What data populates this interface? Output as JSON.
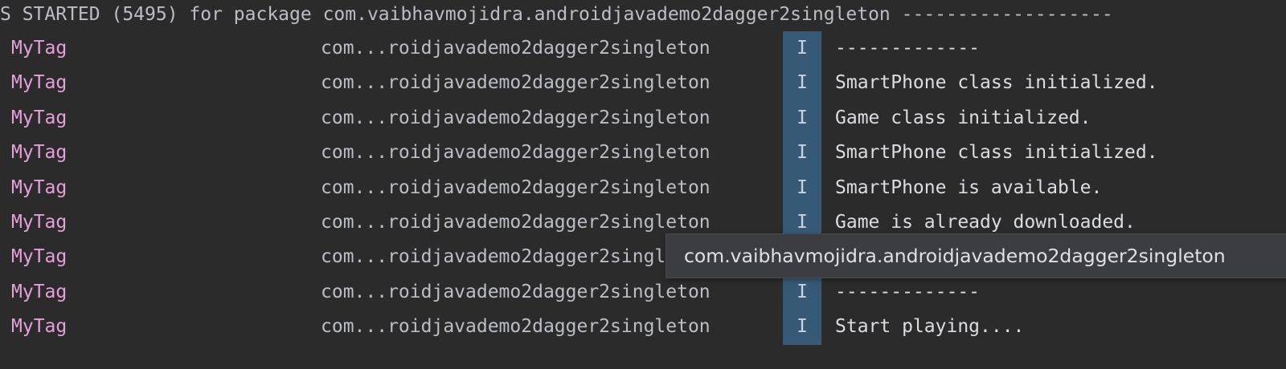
{
  "header": {
    "text": "S STARTED (5495) for package com.vaibhavmojidra.androidjavademo2dagger2singleton -------------------"
  },
  "rows": [
    {
      "tag": "MyTag",
      "package": "com...roidjavademo2dagger2singleton",
      "level": "I",
      "message": "-------------"
    },
    {
      "tag": "MyTag",
      "package": "com...roidjavademo2dagger2singleton",
      "level": "I",
      "message": "SmartPhone class initialized."
    },
    {
      "tag": "MyTag",
      "package": "com...roidjavademo2dagger2singleton",
      "level": "I",
      "message": "Game class initialized."
    },
    {
      "tag": "MyTag",
      "package": "com...roidjavademo2dagger2singleton",
      "level": "I",
      "message": "SmartPhone class initialized."
    },
    {
      "tag": "MyTag",
      "package": "com...roidjavademo2dagger2singleton",
      "level": "I",
      "message": "SmartPhone is available."
    },
    {
      "tag": "MyTag",
      "package": "com...roidjavademo2dagger2singleton",
      "level": "I",
      "message": "Game is already downloaded."
    },
    {
      "tag": "MyTag",
      "package": "com...roidjavademo2dagger2singleton",
      "level": "I",
      "message": ""
    },
    {
      "tag": "MyTag",
      "package": "com...roidjavademo2dagger2singleton",
      "level": "I",
      "message": "-------------"
    },
    {
      "tag": "MyTag",
      "package": "com...roidjavademo2dagger2singleton",
      "level": "I",
      "message": "Start playing...."
    }
  ],
  "tooltip": {
    "text": "com.vaibhavmojidra.androidjavademo2dagger2singleton"
  },
  "colors": {
    "background": "#2b2b2b",
    "tag": "#e79fdc",
    "level_badge": "#365a75",
    "tooltip_bg": "#3c3d40"
  }
}
